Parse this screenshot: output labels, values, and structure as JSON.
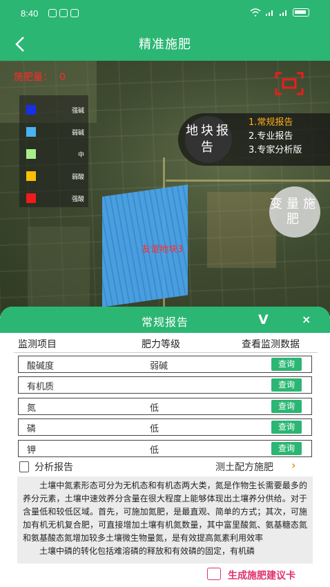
{
  "status_bar": {
    "time": "8:40"
  },
  "nav": {
    "title": "精准施肥"
  },
  "map": {
    "fertilizer_count_label": "施肥量：",
    "fertilizer_count_value": "0",
    "field_label": "友谊地块3",
    "legend": [
      {
        "label": "强碱",
        "color": "#1530e6"
      },
      {
        "label": "弱碱",
        "color": "#4ab3f0"
      },
      {
        "label": "中",
        "color": "#a8ee88"
      },
      {
        "label": "弱酸",
        "color": "#ffc000"
      },
      {
        "label": "强酸",
        "color": "#ee1c1c"
      }
    ],
    "land_report_button": "地块报告",
    "report_options": [
      "1.常规报告",
      "2.专业报告",
      "3.专家分析版"
    ],
    "variable_button": "变量施肥"
  },
  "sheet": {
    "title": "常规报告",
    "collapse_glyph": "V",
    "close_glyph": "×",
    "columns": [
      "监测项目",
      "肥力等级",
      "查看监测数据"
    ],
    "rows": [
      {
        "name": "酸碱度",
        "level": "弱碱",
        "action": "查询"
      },
      {
        "name": "有机质",
        "level": "",
        "action": "查询"
      },
      {
        "name": "氮",
        "level": "低",
        "action": "查询"
      },
      {
        "name": "磷",
        "level": "低",
        "action": "查询"
      },
      {
        "name": "钾",
        "level": "低",
        "action": "查询"
      }
    ],
    "analysis_title": "分析报告",
    "plan_link": "测土配方施肥",
    "analysis_paragraphs": [
      "土壤中氮素形态可分为无机态和有机态两大类，氮是作物生长需要最多的养分元素，土壤中速效养分含量在很大程度上能够体现出土壤养分供给。对于含量低和较低区域。首先，可施加氮肥，是最直观、简单的方式；其次，可施加有机无机复合肥，可直接增加土壤有机氮数量，其中富里酸氮、氨基糖态氮和氨基酸态氮增加较多土壤微生物量氮，是有效提高氮素利用效率",
      "土壤中磷的转化包括难溶磷的释放和有效磷的固定，有机磷"
    ],
    "generate_card": "生成施肥建议卡"
  },
  "colors": {
    "accent": "#2bb673",
    "alert": "#ff2b2b",
    "highlight": "#ffb020",
    "pink": "#e0306e"
  }
}
